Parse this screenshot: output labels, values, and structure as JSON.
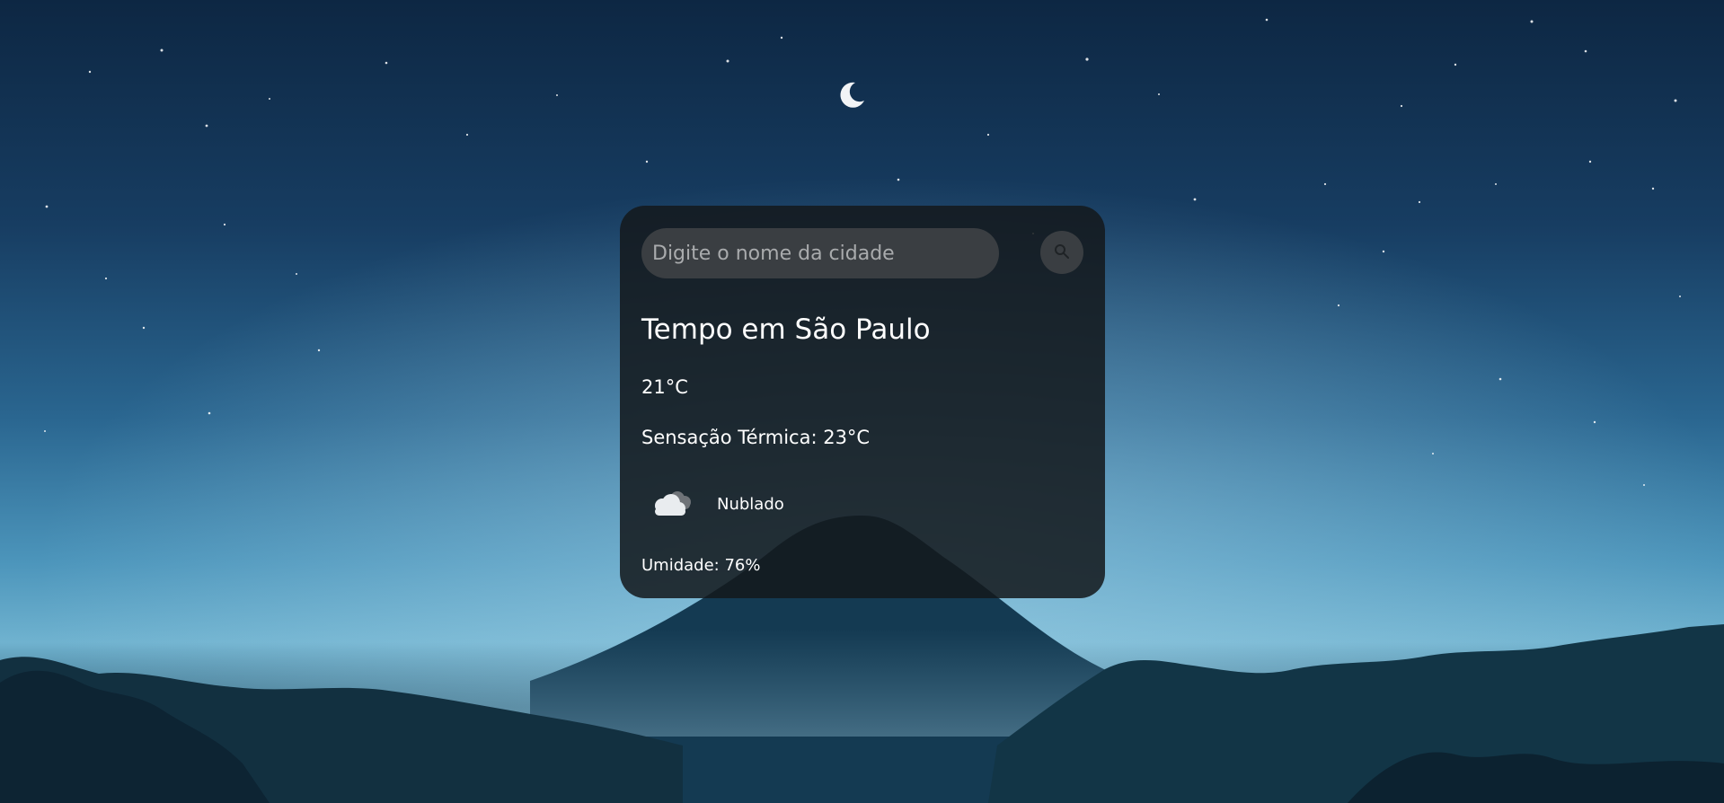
{
  "search": {
    "placeholder": "Digite o nome da cidade",
    "value": "",
    "button_icon": "search-icon"
  },
  "weather": {
    "title": "Tempo em São Paulo",
    "temperature": "21°C",
    "feels_like": "Sensação Térmica: 23°C",
    "condition": "Nublado",
    "condition_icon": "cloud-icon",
    "humidity": "Umidade: 76%"
  }
}
